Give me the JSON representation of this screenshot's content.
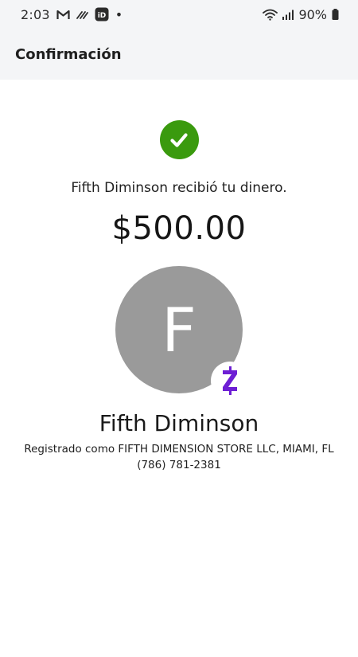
{
  "status_bar": {
    "time": "2:03",
    "battery_percent": "90%",
    "dot": "•",
    "icons": [
      "gmail-icon",
      "signal-app-icon",
      "id-app-icon",
      "wifi-icon",
      "cell-signal-icon",
      "battery-icon"
    ]
  },
  "header": {
    "title": "Confirmación"
  },
  "confirmation": {
    "message": "Fifth Diminson recibió tu dinero.",
    "amount": "$500.00",
    "status_icon": "checkmark-icon",
    "status_color": "#3a9a0e"
  },
  "recipient": {
    "initial": "F",
    "name": "Fifth Diminson",
    "registered_as": "Registrado como FIFTH DIMENSION STORE LLC, MIAMI, FL",
    "phone": "(786) 781-2381",
    "avatar_color": "#9a9a9a",
    "badge_icon": "zelle-icon",
    "badge_color": "#6d1ed4"
  }
}
